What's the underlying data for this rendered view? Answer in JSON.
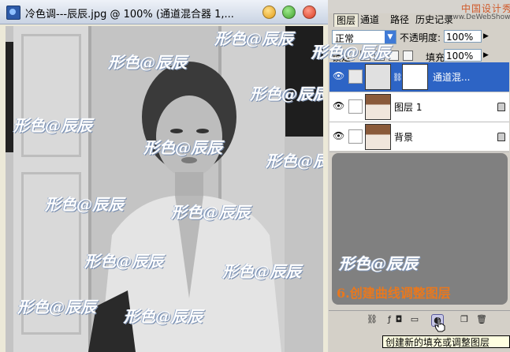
{
  "document": {
    "title": "冷色调---辰辰.jpg @ 100% (通道混合器 1,...",
    "watermark_text": "形色@辰辰"
  },
  "layers_panel": {
    "tabs": [
      "图层",
      "通道",
      "路径",
      "历史记录"
    ],
    "blend_mode": "正常",
    "opacity_label": "不透明度:",
    "opacity_value": "100%",
    "lock_label": "锁定:",
    "fill_label": "填充:",
    "fill_value": "100%",
    "layers": [
      {
        "name": "通道混...",
        "selected": true,
        "visible": true,
        "locked": false
      },
      {
        "name": "图层 1",
        "selected": false,
        "visible": true,
        "locked": true
      },
      {
        "name": "背景",
        "selected": false,
        "visible": true,
        "locked": true
      }
    ],
    "bottom_buttons": [
      "link-icon",
      "layer-style-icon",
      "mask-icon",
      "folder-icon",
      "adjustment-layer-icon",
      "new-layer-icon",
      "trash-icon"
    ]
  },
  "annotation": {
    "step_caption": "6.创建曲线调整图层"
  },
  "tooltip": {
    "text": "创建新的填充或调整图层"
  },
  "site_mark": {
    "chinese": "中国设计秀",
    "english": "www.DeWebShow.com"
  },
  "colors": {
    "selected_layer": "#2d64c5",
    "caption": "#e8781e",
    "panel_bg": "#d4d0c8"
  }
}
